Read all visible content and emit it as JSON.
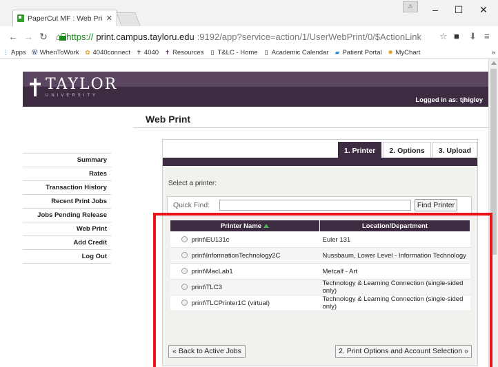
{
  "browser": {
    "tab_title": "PaperCut MF : Web Print -",
    "url_https": "https://",
    "url_host": "print.campus.tayloru.edu",
    "url_path": ":9192/app?service=action/1/UserWebPrint/0/$ActionLink",
    "profile_badge": "⚠",
    "bookmarks": [
      "Apps",
      "WhenToWork",
      "4040connect",
      "4040",
      "Resources",
      "T&LC - Home",
      "Academic Calendar",
      "Patient Portal",
      "MyChart"
    ],
    "bookmarks_overflow": "»"
  },
  "header": {
    "logo_title": "TAYLOR",
    "logo_subtitle": "UNIVERSITY",
    "logged_in_text": "Logged in as: tjhigley"
  },
  "sidebar": {
    "items": [
      "Summary",
      "Rates",
      "Transaction History",
      "Recent Print Jobs",
      "Jobs Pending Release",
      "Web Print",
      "Add Credit",
      "Log Out"
    ]
  },
  "main": {
    "title": "Web Print",
    "steps": [
      "1. Printer",
      "2. Options",
      "3. Upload"
    ],
    "select_label": "Select a printer:",
    "quick_find_label": "Quick Find:",
    "quick_find_value": "",
    "find_button": "Find Printer",
    "table": {
      "headers": [
        "Printer Name",
        "Location/Department"
      ],
      "rows": [
        {
          "name": "print\\EU131c",
          "location": "Euler 131"
        },
        {
          "name": "print\\InformationTechnology2C",
          "location": "Nussbaum, Lower Level - Information Technology"
        },
        {
          "name": "print\\MacLab1",
          "location": "Metcalf - Art"
        },
        {
          "name": "print\\TLC3",
          "location": "Technology & Learning Connection (single-sided only)"
        },
        {
          "name": "print\\TLCPrinter1C (virtual)",
          "location": "Technology & Learning Connection (single-sided only)"
        }
      ]
    },
    "back_button": "« Back to Active Jobs",
    "next_button": "2. Print Options and Account Selection »"
  },
  "colors": {
    "brand_purple": "#3d2b42",
    "highlight_red": "#e8141b",
    "secure_green": "#1a8a1a"
  }
}
